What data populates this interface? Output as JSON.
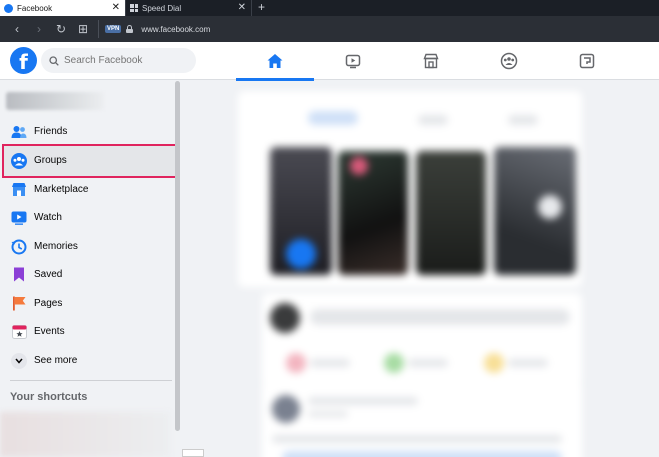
{
  "browser": {
    "tabs": [
      {
        "title": "Facebook",
        "close": "✕"
      },
      {
        "title": "Speed Dial",
        "close": "✕"
      }
    ],
    "new_tab": "+",
    "nav": {
      "back": "‹",
      "forward": "›",
      "reload": "↻",
      "speed_dial": "⊞"
    },
    "vpn_label": "VPN",
    "url": "www.facebook.com"
  },
  "header": {
    "logo": "f",
    "search_placeholder": "Search Facebook",
    "tabs": [
      "home-icon",
      "watch-icon",
      "marketplace-icon",
      "groups-icon",
      "gaming-icon"
    ],
    "brand_color": "#1877f2"
  },
  "sidebar": {
    "items": [
      {
        "label": "Friends",
        "icon": "friends-icon"
      },
      {
        "label": "Groups",
        "icon": "groups-icon"
      },
      {
        "label": "Marketplace",
        "icon": "marketplace-icon"
      },
      {
        "label": "Watch",
        "icon": "watch-icon"
      },
      {
        "label": "Memories",
        "icon": "memories-icon"
      },
      {
        "label": "Saved",
        "icon": "saved-icon"
      },
      {
        "label": "Pages",
        "icon": "pages-icon"
      },
      {
        "label": "Events",
        "icon": "events-icon"
      },
      {
        "label": "See more",
        "icon": "chevron-down-icon"
      }
    ],
    "shortcuts_title": "Your shortcuts",
    "highlight_color": "#e0245e"
  }
}
